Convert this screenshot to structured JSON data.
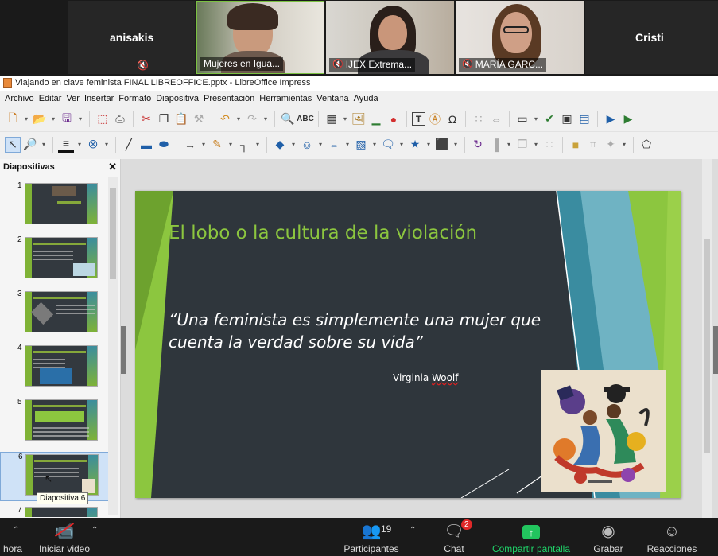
{
  "zoom": {
    "participants": [
      {
        "name": "anisakis",
        "caption": ""
      },
      {
        "name": "",
        "caption": "Mujeres en Igua..."
      },
      {
        "name": "",
        "caption": "IJEX Extrema..."
      },
      {
        "name": "",
        "caption": "MARÍA GARC..."
      },
      {
        "name": "Cristi",
        "caption": ""
      }
    ],
    "bottom": {
      "hora": "hora",
      "video": "Iniciar video",
      "participants": "Participantes",
      "participants_count": "19",
      "chat": "Chat",
      "chat_badge": "2",
      "share": "Compartir pantalla",
      "record": "Grabar",
      "reactions": "Reacciones"
    }
  },
  "window": {
    "title": "Viajando en clave feminista FINAL LIBREOFFICE.pptx - LibreOffice Impress",
    "menu": [
      "Archivo",
      "Editar",
      "Ver",
      "Insertar",
      "Formato",
      "Diapositiva",
      "Presentación",
      "Herramientas",
      "Ventana",
      "Ayuda"
    ]
  },
  "panel": {
    "title": "Diapositivas",
    "slides": [
      "1",
      "2",
      "3",
      "4",
      "5",
      "6",
      "7"
    ],
    "tooltip": "Diapositiva 6"
  },
  "slide": {
    "title": "El lobo o la cultura de la violación",
    "quote": "“Una feminista es simplemente una mujer que cuenta la verdad sobre su vida”",
    "author_first": "Virginia ",
    "author_last": "Woolf"
  },
  "colors": {
    "slide_bg": "#2f363c",
    "accent_green": "#8cc63f",
    "teal": "#3a8ca0",
    "share_green": "#22c55e"
  }
}
